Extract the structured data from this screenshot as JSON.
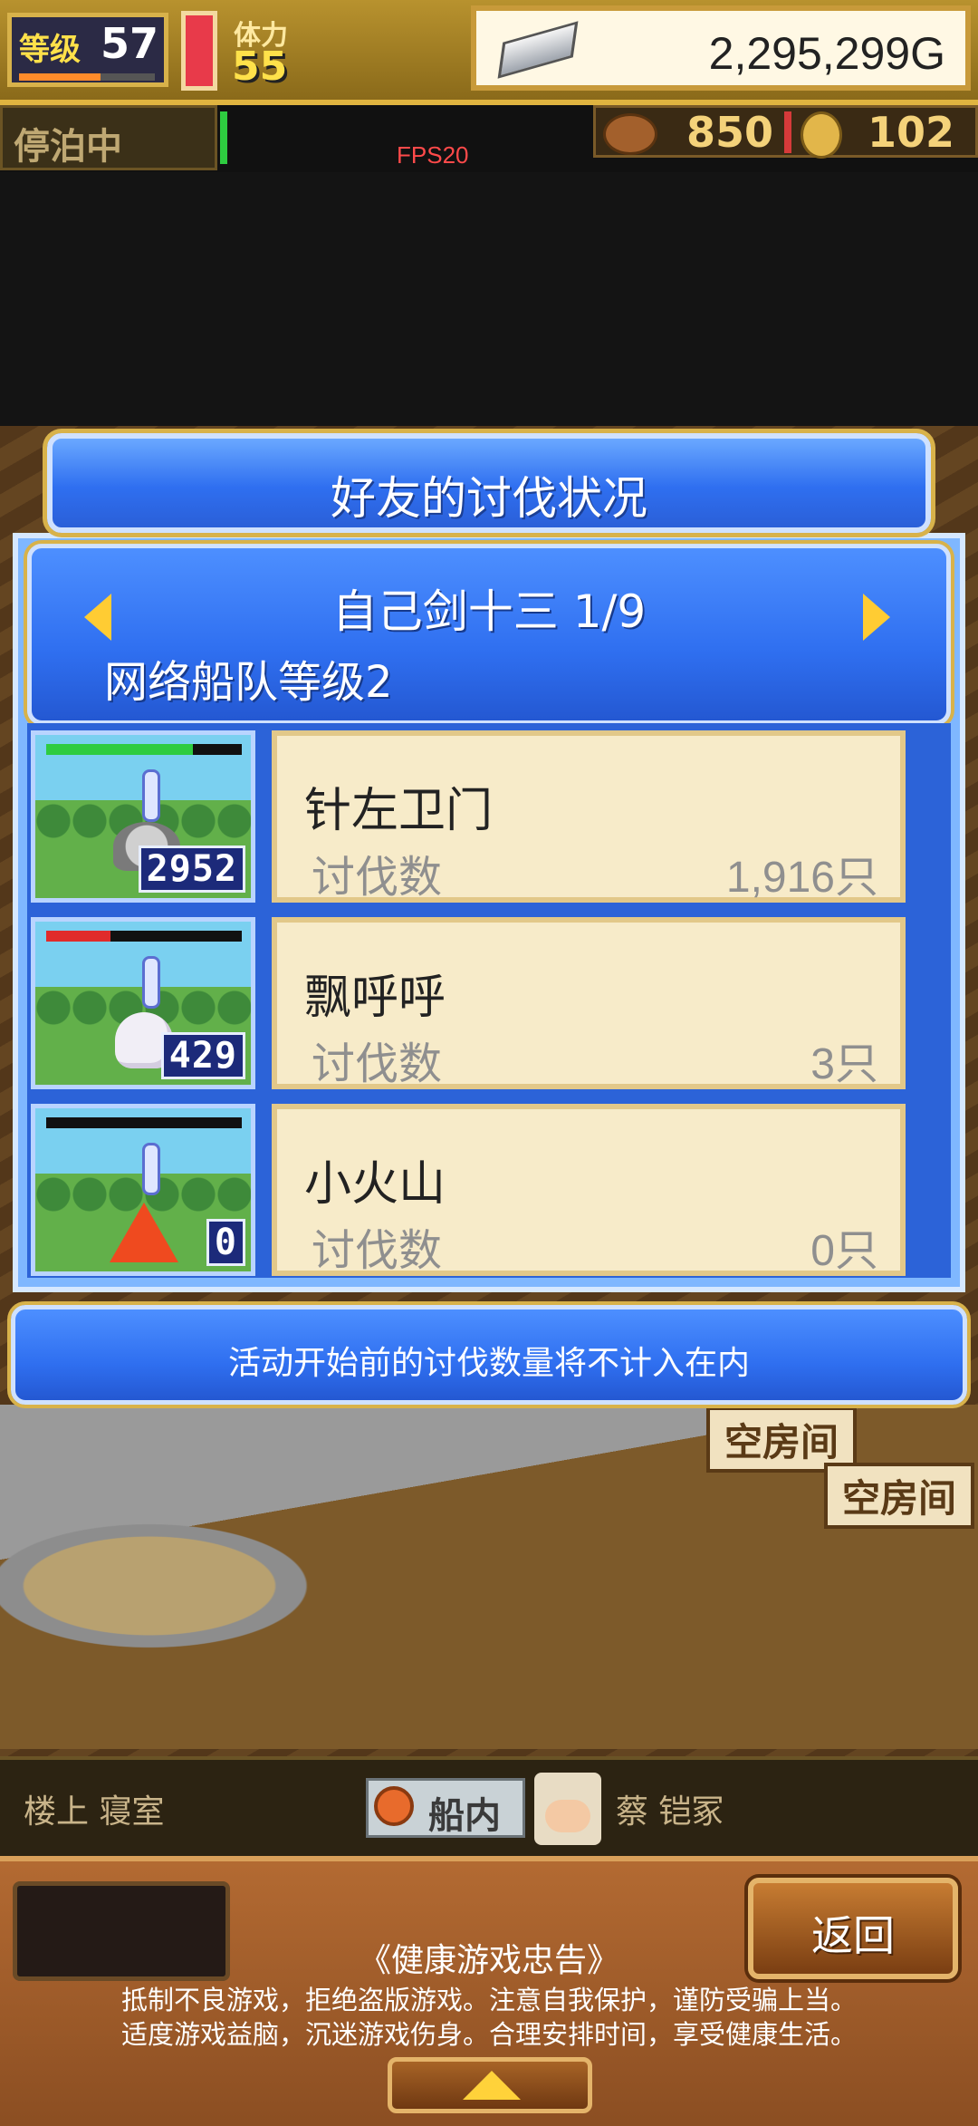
{
  "status": {
    "level_label": "等级",
    "level": "57",
    "stamina_label": "体力",
    "stamina": "55",
    "gold": "2,295,299G",
    "dock_status": "停泊中",
    "fps": "FPS20",
    "food": "850",
    "coins": "102"
  },
  "dialog": {
    "title": "好友的讨伐状况",
    "player_name": "自己剑十三 1/9",
    "fleet_level": "网络船队等级2",
    "rows": [
      {
        "monster": "针左卫门",
        "kill_label": "讨伐数",
        "kills": "1,916只",
        "thumb_count": "2952",
        "hp_color": "#2ecc40",
        "hp_fill": 0.75
      },
      {
        "monster": "飘呼呼",
        "kill_label": "讨伐数",
        "kills": "3只",
        "thumb_count": "429",
        "hp_color": "#e02b2b",
        "hp_fill": 0.33
      },
      {
        "monster": "小火山",
        "kill_label": "讨伐数",
        "kills": "0只",
        "thumb_count": "0",
        "hp_color": "#111111",
        "hp_fill": 0
      }
    ],
    "notice": "活动开始前的讨伐数量将不计入在内"
  },
  "world": {
    "room_sign_1": "空房间",
    "room_sign_2": "空房间"
  },
  "location": {
    "left": "楼上 寝室",
    "current": "船内",
    "right": "蔡 铠冢"
  },
  "bottom": {
    "back_label": "返回",
    "health_title": "《健康游戏忠告》",
    "health_line1": "抵制不良游戏，拒绝盗版游戏。注意自我保护，谨防受骗上当。",
    "health_line2": "适度游戏益脑，沉迷游戏伤身。合理安排时间，享受健康生活。"
  }
}
